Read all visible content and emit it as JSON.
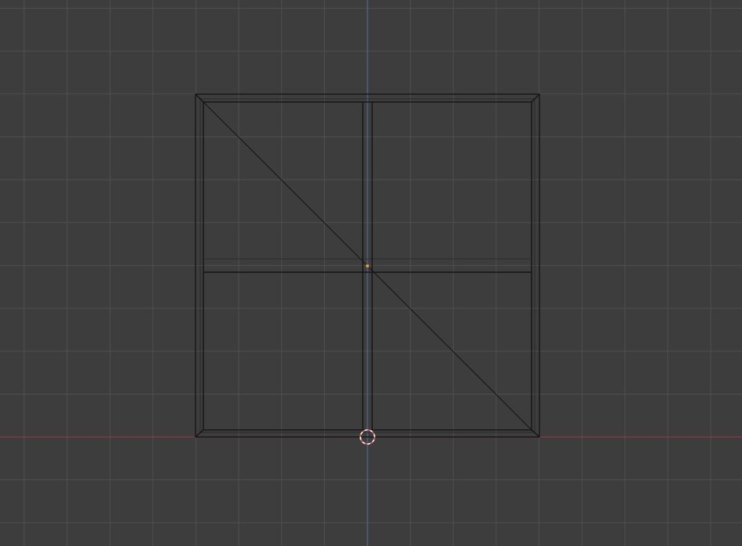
{
  "viewport": {
    "background_color": "#3d3d3d",
    "grid_color": "#4f4f4f",
    "x_axis_color": "#8a3a44",
    "z_axis_color": "#4a6a92",
    "wire_color": "#141414",
    "origin_color": "#f0a050",
    "cursor_colors": [
      "#d64a4a",
      "#ffffff"
    ]
  }
}
